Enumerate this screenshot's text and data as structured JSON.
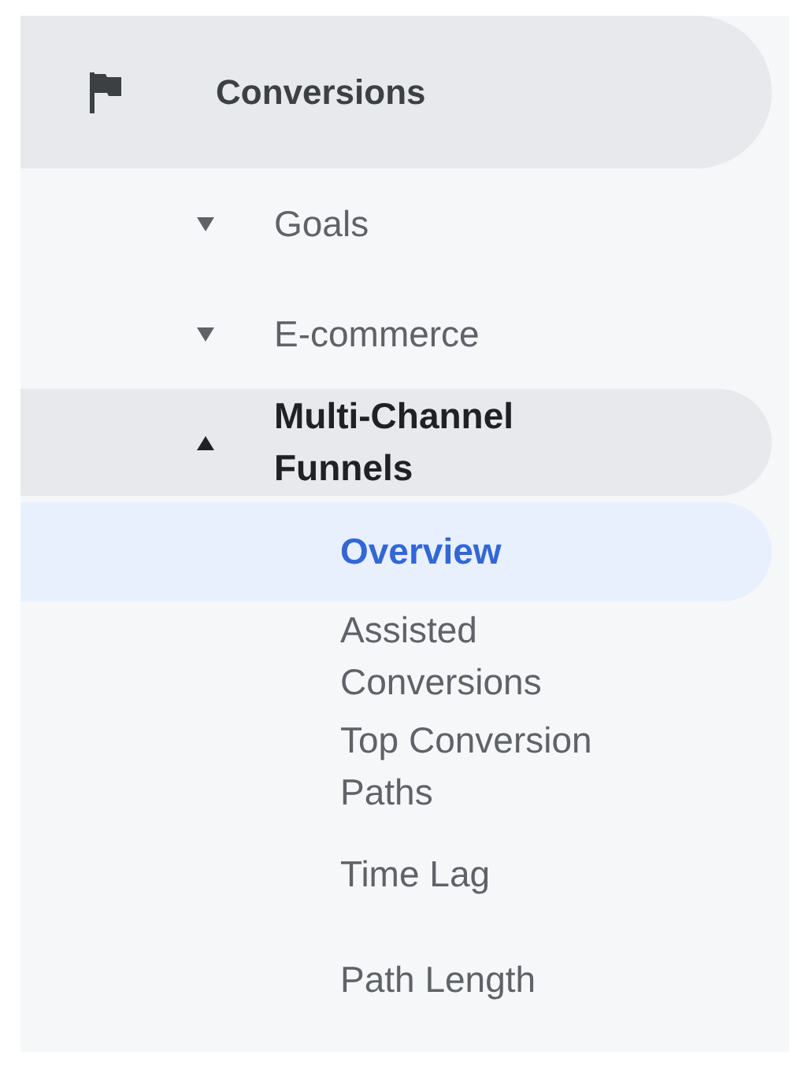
{
  "section": {
    "label": "Conversions"
  },
  "items": [
    {
      "label": "Goals",
      "expanded": false
    },
    {
      "label": "E-commerce",
      "expanded": false
    },
    {
      "label": "Multi-Channel Funnels",
      "expanded": true,
      "children": [
        {
          "label": "Overview",
          "selected": true
        },
        {
          "label": "Assisted Conversions",
          "selected": false
        },
        {
          "label": "Top Conversion Paths",
          "selected": false
        },
        {
          "label": "Time Lag",
          "selected": false
        },
        {
          "label": "Path Length",
          "selected": false
        }
      ]
    }
  ]
}
